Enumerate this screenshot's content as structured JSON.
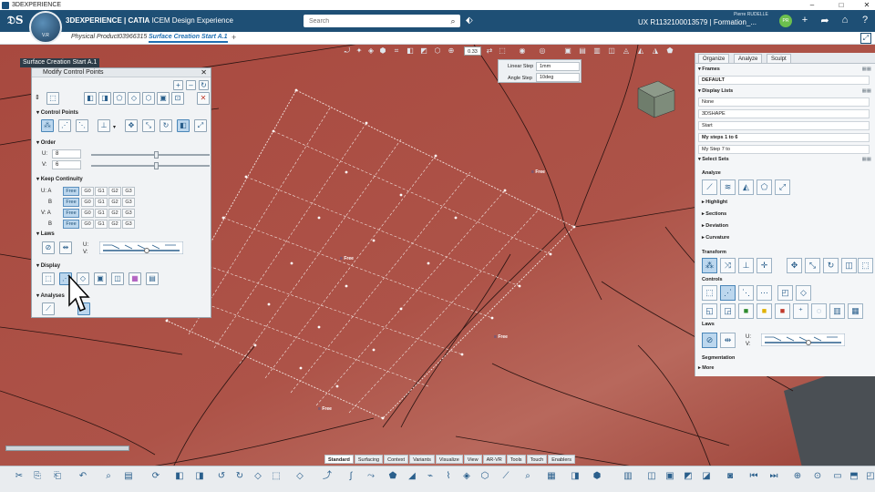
{
  "app": {
    "window_title": "3DEXPERIENCE",
    "brand_prefix": "3DEXPERIENCE | CATIA",
    "brand_suffix": "ICEM Design Experience",
    "compass_version": "V.R"
  },
  "header": {
    "search_placeholder": "Search",
    "user_name": "Pierre RUDELLE",
    "doc_title": "UX R1132100013579 | Formation_...",
    "avatar_initials": "PR"
  },
  "tabs": [
    {
      "label": "Physical Product03966315",
      "active": false
    },
    {
      "label": "Surface Creation Start A.1",
      "active": true
    }
  ],
  "tree": {
    "root_label": "Surface Creation Start A.1"
  },
  "viewport": {
    "zoom_value": "0.33",
    "step": {
      "linear_label": "Linear Step",
      "linear_value": "1mm",
      "angle_label": "Angle Step",
      "angle_value": "10deg"
    },
    "free_labels": [
      "Free",
      "Free",
      "Free",
      "Free"
    ]
  },
  "modify_panel": {
    "title": "Modify Control Points",
    "sections": {
      "control_points": "Control Points",
      "order": "Order",
      "keep_continuity": "Keep Continuity",
      "laws": "Laws",
      "display": "Display",
      "analyses": "Analyses"
    },
    "order": {
      "u_label": "U:",
      "u_value": "8",
      "v_label": "V:",
      "v_value": "6",
      "u_fraction": 0.55,
      "v_fraction": 0.55
    },
    "continuity_rows": [
      {
        "label": "U: A",
        "cells": [
          "Free",
          "G0",
          "G1",
          "G2",
          "G3"
        ]
      },
      {
        "label": "B",
        "cells": [
          "Free",
          "G0",
          "G1",
          "G2",
          "G3"
        ]
      },
      {
        "label": "V: A",
        "cells": [
          "Free",
          "G0",
          "G1",
          "G2",
          "G3"
        ]
      },
      {
        "label": "B",
        "cells": [
          "Free",
          "G0",
          "G1",
          "G2",
          "G3"
        ]
      }
    ],
    "laws": {
      "u_label": "U:",
      "v_label": "V:"
    }
  },
  "right_panel": {
    "tabs": [
      "Organize",
      "Analyze",
      "Sculpt"
    ],
    "frames_label": "Frames",
    "frames_value": "DEFAULT",
    "display_lists_label": "Display Lists",
    "display_lists": [
      "None",
      "3DSHAPE",
      "Start",
      "My steps 1 to 6",
      "My Step 7 to"
    ],
    "select_sets_label": "Select Sets",
    "analyze_label": "Analyze",
    "collapsed": [
      "Highlight",
      "Sections",
      "Deviation",
      "Curvature"
    ],
    "transform_label": "Transform",
    "controls_label": "Controls",
    "laws_label": "Laws",
    "laws_u": "U:",
    "laws_v": "V:",
    "segmentation_label": "Segmentation",
    "more_label": "More"
  },
  "bottom_tabs": [
    {
      "label": "Standard",
      "active": true
    },
    {
      "label": "Surfacing",
      "active": false
    },
    {
      "label": "Context",
      "active": false
    },
    {
      "label": "Variants",
      "active": false
    },
    {
      "label": "Visualize",
      "active": false
    },
    {
      "label": "View",
      "active": false
    },
    {
      "label": "AR-VR",
      "active": false
    },
    {
      "label": "Tools",
      "active": false
    },
    {
      "label": "Touch",
      "active": false
    },
    {
      "label": "Enablers",
      "active": false
    }
  ],
  "colors": {
    "header": "#1e4f75",
    "surface": "#a44a40",
    "accent": "#1e6fb2"
  }
}
